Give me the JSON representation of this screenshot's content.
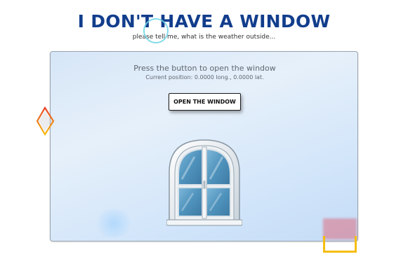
{
  "header": {
    "title": "I DON'T HAVE A WINDOW",
    "subtitle": "please tell me, what is the weather outside..."
  },
  "panel": {
    "prompt": "Press the button to open the window",
    "position_text": "Current position: 0.0000 long., 0.0000 lat.",
    "button_label": "OPEN THE WINDOW"
  },
  "colors": {
    "title": "#123d8c",
    "panel_bg": "#dde9f7",
    "window_glass": "#5aa0c8",
    "diamond_red": "#e8402a",
    "diamond_yellow": "#f5be12",
    "box_yellow": "#f5be12"
  },
  "icons": {
    "window": "closed-window-icon",
    "cursor": "cursor-ring-icon"
  }
}
